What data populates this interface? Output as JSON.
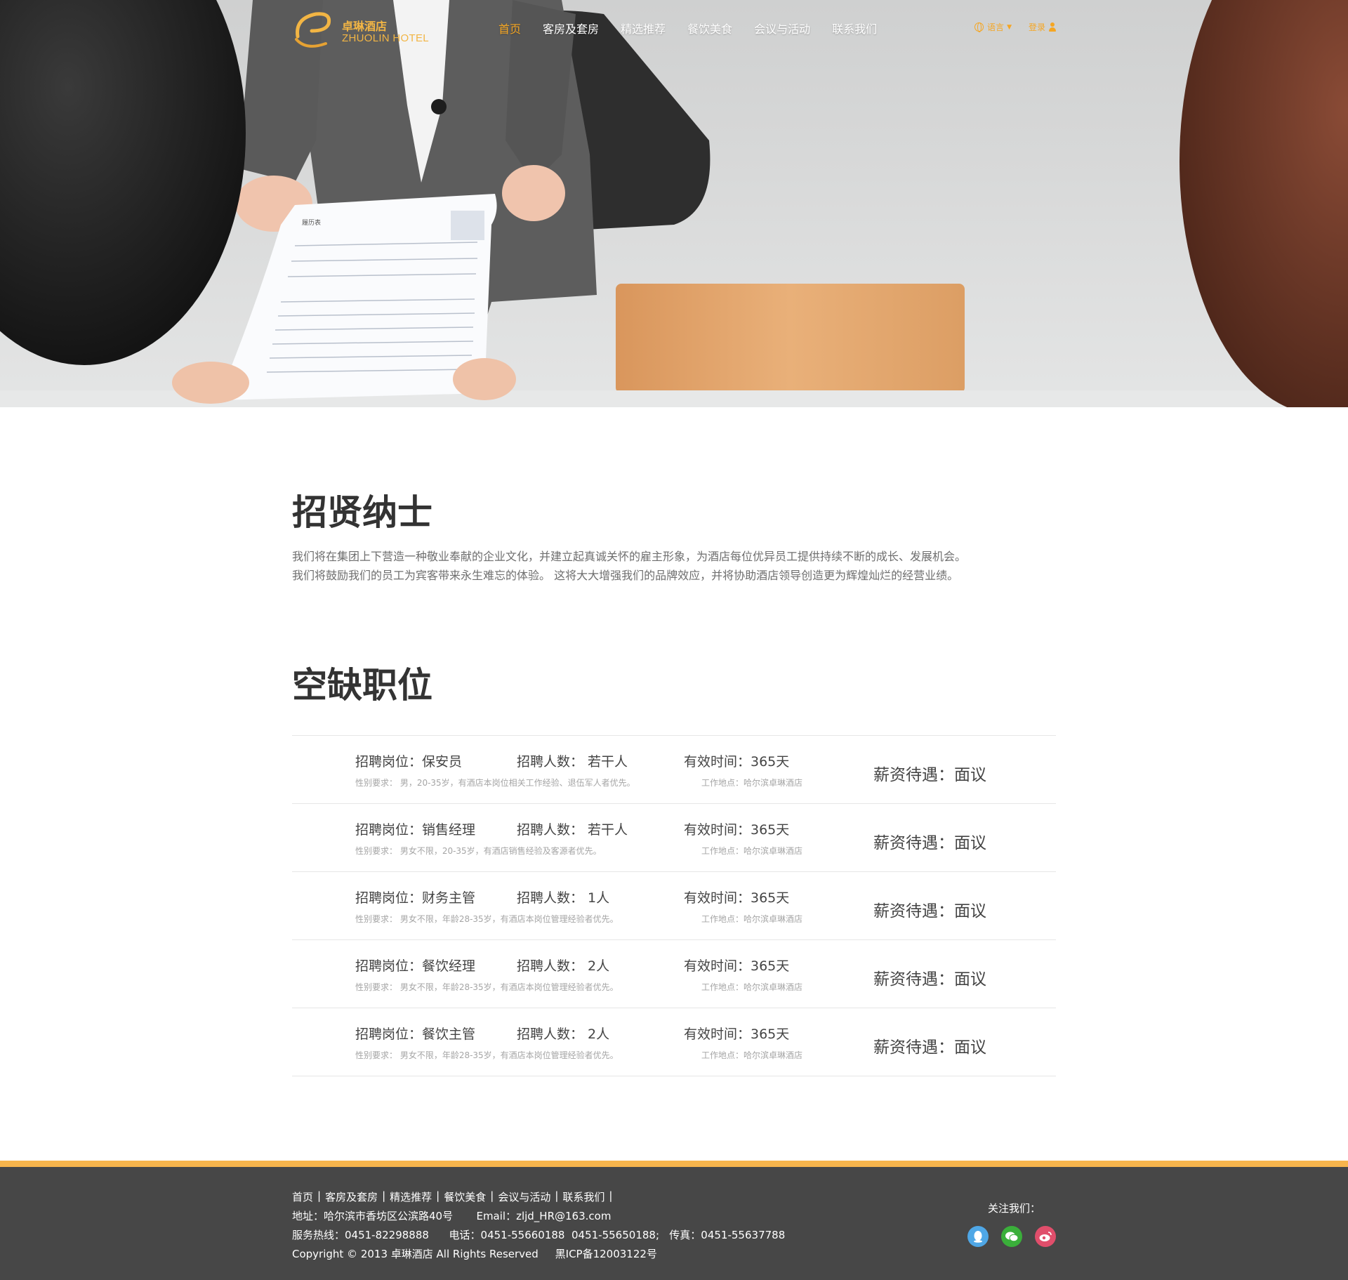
{
  "brand": {
    "name_cn": "卓琳酒店",
    "name_en": "ZHUOLIN HOTEL",
    "accent_color": "#f5a623",
    "footer_stripe_color": "#f7b54c"
  },
  "nav": {
    "items": [
      {
        "label": "首页",
        "active": true
      },
      {
        "label": "客房及套房"
      },
      {
        "label": "精选推荐"
      },
      {
        "label": "餐饮美食"
      },
      {
        "label": "会议与活动"
      },
      {
        "label": "联系我们"
      }
    ],
    "language_label": "语言",
    "login_label": "登录"
  },
  "hero": {
    "resume_title": "履历表"
  },
  "recruit": {
    "title": "招贤纳士",
    "intro_lines": [
      "我们将在集团上下营造一种敬业奉献的企业文化，并建立起真诚关怀的雇主形象，为酒店每位优异员工提供持续不断的成长、发展机会。",
      "我们将鼓励我们的员工为宾客带来永生难忘的体验。 这将大大增强我们的品牌效应，并将协助酒店领导创造更为辉煌灿烂的经营业绩。"
    ]
  },
  "vacancies": {
    "title": "空缺职位",
    "jobs": [
      {
        "position": "招聘岗位：保安员",
        "count": "招聘人数： 若干人",
        "valid": "有效时间：365天",
        "requirement": "性别要求：  男，20-35岁，有酒店本岗位相关工作经验、退伍军人者优先。",
        "location": "工作地点：哈尔滨卓琳酒店",
        "salary": "薪资待遇：面议"
      },
      {
        "position": "招聘岗位：销售经理",
        "count": "招聘人数： 若干人",
        "valid": "有效时间：365天",
        "requirement": "性别要求：  男女不限，20-35岁，有酒店销售经验及客源者优先。",
        "location": "工作地点：哈尔滨卓琳酒店",
        "salary": "薪资待遇：面议"
      },
      {
        "position": "招聘岗位：财务主管",
        "count": "招聘人数： 1人",
        "valid": "有效时间：365天",
        "requirement": "性别要求：  男女不限，年龄28-35岁，有酒店本岗位管理经验者优先。",
        "location": "工作地点：哈尔滨卓琳酒店",
        "salary": "薪资待遇：面议"
      },
      {
        "position": "招聘岗位：餐饮经理",
        "count": "招聘人数： 2人",
        "valid": "有效时间：365天",
        "requirement": "性别要求：  男女不限，年龄28-35岁，有酒店本岗位管理经验者优先。",
        "location": "工作地点：哈尔滨卓琳酒店",
        "salary": "薪资待遇：面议"
      },
      {
        "position": "招聘岗位：餐饮主管",
        "count": "招聘人数： 2人",
        "valid": "有效时间：365天",
        "requirement": "性别要求：  男女不限，年龄28-35岁，有酒店本岗位管理经验者优先。",
        "location": "工作地点：哈尔滨卓琳酒店",
        "salary": "薪资待遇：面议"
      }
    ]
  },
  "footer": {
    "links": [
      "首页",
      "客房及套房",
      "精选推荐",
      "餐饮美食",
      "会议与活动",
      "联系我们"
    ],
    "separator": "|",
    "address": "地址：哈尔滨市香坊区公滨路40号       Email：zljd_HR@163.com",
    "hotline": "服务热线：0451-82298888      电话：0451-55660188  0451-55650188;   传真：0451-55637788",
    "copyright": "Copyright © 2013 卓琳酒店 All Rights Reserved     黑ICP备12003122号",
    "follow_label": "关注我们：",
    "social": [
      {
        "icon": "qq-icon",
        "color": "#4fa7e6"
      },
      {
        "icon": "wechat-icon",
        "color": "#3aaf3a"
      },
      {
        "icon": "weibo-icon",
        "color": "#e04e6b"
      }
    ]
  }
}
